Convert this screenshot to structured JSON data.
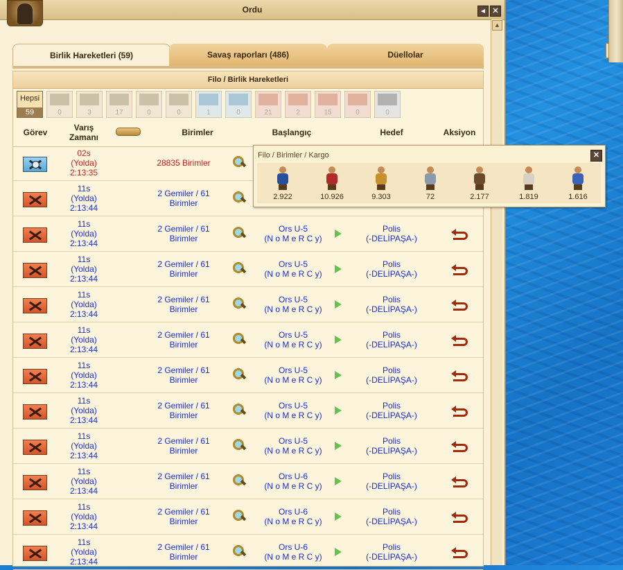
{
  "window": {
    "title": "Ordu",
    "back_icon": "back-arrow-icon",
    "close_icon": "close-icon"
  },
  "tabs": [
    {
      "label": "Birlik Hareketleri (59)",
      "active": true
    },
    {
      "label": "Savaş raporları (486)",
      "active": false
    },
    {
      "label": "Düellolar",
      "active": false
    }
  ],
  "panel": {
    "title": "Filo / Birlik Hareketleri"
  },
  "filters": [
    {
      "label": "Hepsi",
      "count": "59",
      "active": true
    },
    {
      "icon": "transport-ship-icon",
      "count": "0"
    },
    {
      "icon": "army-icon",
      "count": "3"
    },
    {
      "icon": "fleet-icon",
      "count": "17"
    },
    {
      "icon": "trade-icon",
      "count": "0"
    },
    {
      "icon": "goods-icon",
      "count": "0"
    },
    {
      "icon": "espionage-icon",
      "count": "1"
    },
    {
      "icon": "colony-icon",
      "count": "0"
    },
    {
      "icon": "plunder-icon",
      "count": "21"
    },
    {
      "icon": "occupy-icon",
      "count": "2"
    },
    {
      "icon": "defend-city-icon",
      "count": "15"
    },
    {
      "icon": "blockade-icon",
      "count": "0"
    },
    {
      "icon": "pirate-icon",
      "count": "0"
    }
  ],
  "columns": {
    "mission": "Görev",
    "arrival": "Varış Zamanı",
    "units": "Birimler",
    "origin": "Başlangıç",
    "target": "Hedef",
    "action": "Aksiyon"
  },
  "rows": [
    {
      "mission": "espionage",
      "time_left": "02s",
      "status": "(Yolda)",
      "clock": "2:13:35",
      "units": "28835 Birimler",
      "units_red": true,
      "origin_1": "",
      "origin_2": "",
      "target_1": "",
      "target_2": ""
    },
    {
      "mission": "plunder",
      "time_left": "11s",
      "status": "(Yolda)",
      "clock": "2:13:44",
      "units": "2 Gemiler / 61 Birimler",
      "origin_1": "",
      "origin_2": "",
      "target_1": "",
      "target_2": ""
    },
    {
      "mission": "plunder",
      "time_left": "11s",
      "status": "(Yolda)",
      "clock": "2:13:44",
      "units": "2 Gemiler / 61 Birimler",
      "origin_1": "Ors U-5",
      "origin_2": "(N o M e R C y)",
      "target_1": "Polis",
      "target_2": "(-DELİPAŞA-)"
    },
    {
      "mission": "plunder",
      "time_left": "11s",
      "status": "(Yolda)",
      "clock": "2:13:44",
      "units": "2 Gemiler / 61 Birimler",
      "origin_1": "Ors U-5",
      "origin_2": "(N o M e R C y)",
      "target_1": "Polis",
      "target_2": "(-DELİPAŞA-)"
    },
    {
      "mission": "plunder",
      "time_left": "11s",
      "status": "(Yolda)",
      "clock": "2:13:44",
      "units": "2 Gemiler / 61 Birimler",
      "origin_1": "Ors U-5",
      "origin_2": "(N o M e R C y)",
      "target_1": "Polis",
      "target_2": "(-DELİPAŞA-)"
    },
    {
      "mission": "plunder",
      "time_left": "11s",
      "status": "(Yolda)",
      "clock": "2:13:44",
      "units": "2 Gemiler / 61 Birimler",
      "origin_1": "Ors U-5",
      "origin_2": "(N o M e R C y)",
      "target_1": "Polis",
      "target_2": "(-DELİPAŞA-)"
    },
    {
      "mission": "plunder",
      "time_left": "11s",
      "status": "(Yolda)",
      "clock": "2:13:44",
      "units": "2 Gemiler / 61 Birimler",
      "origin_1": "Ors U-5",
      "origin_2": "(N o M e R C y)",
      "target_1": "Polis",
      "target_2": "(-DELİPAŞA-)"
    },
    {
      "mission": "plunder",
      "time_left": "11s",
      "status": "(Yolda)",
      "clock": "2:13:44",
      "units": "2 Gemiler / 61 Birimler",
      "origin_1": "Ors U-5",
      "origin_2": "(N o M e R C y)",
      "target_1": "Polis",
      "target_2": "(-DELİPAŞA-)"
    },
    {
      "mission": "plunder",
      "time_left": "11s",
      "status": "(Yolda)",
      "clock": "2:13:44",
      "units": "2 Gemiler / 61 Birimler",
      "origin_1": "Ors U-5",
      "origin_2": "(N o M e R C y)",
      "target_1": "Polis",
      "target_2": "(-DELİPAŞA-)"
    },
    {
      "mission": "plunder",
      "time_left": "11s",
      "status": "(Yolda)",
      "clock": "2:13:44",
      "units": "2 Gemiler / 61 Birimler",
      "origin_1": "Ors U-6",
      "origin_2": "(N o M e R C y)",
      "target_1": "Polis",
      "target_2": "(-DELİPAŞA-)"
    },
    {
      "mission": "plunder",
      "time_left": "11s",
      "status": "(Yolda)",
      "clock": "2:13:44",
      "units": "2 Gemiler / 61 Birimler",
      "origin_1": "Ors U-6",
      "origin_2": "(N o M e R C y)",
      "target_1": "Polis",
      "target_2": "(-DELİPAŞA-)"
    },
    {
      "mission": "plunder",
      "time_left": "11s",
      "status": "(Yolda)",
      "clock": "2:13:44",
      "units": "2 Gemiler / 61 Birimler",
      "origin_1": "Ors U-6",
      "origin_2": "(N o M e R C y)",
      "target_1": "Polis",
      "target_2": "(-DELİPAŞA-)"
    }
  ],
  "popup": {
    "title": "Filo / Birimler / Kargo",
    "units": [
      {
        "icon": "hoplite-icon",
        "count": "2.922",
        "color": "#2a4f9a"
      },
      {
        "icon": "swordsman-icon",
        "count": "10.926",
        "color": "#b02a2a"
      },
      {
        "icon": "spearman-icon",
        "count": "9.303",
        "color": "#c8902a"
      },
      {
        "icon": "gyrocopter-icon",
        "count": "72",
        "color": "#8a9aa8"
      },
      {
        "icon": "catapult-icon",
        "count": "2.177",
        "color": "#6a4a2a"
      },
      {
        "icon": "doctor-icon",
        "count": "1.819",
        "color": "#d8d0c0"
      },
      {
        "icon": "cook-icon",
        "count": "1.616",
        "color": "#3a62b8"
      }
    ]
  }
}
